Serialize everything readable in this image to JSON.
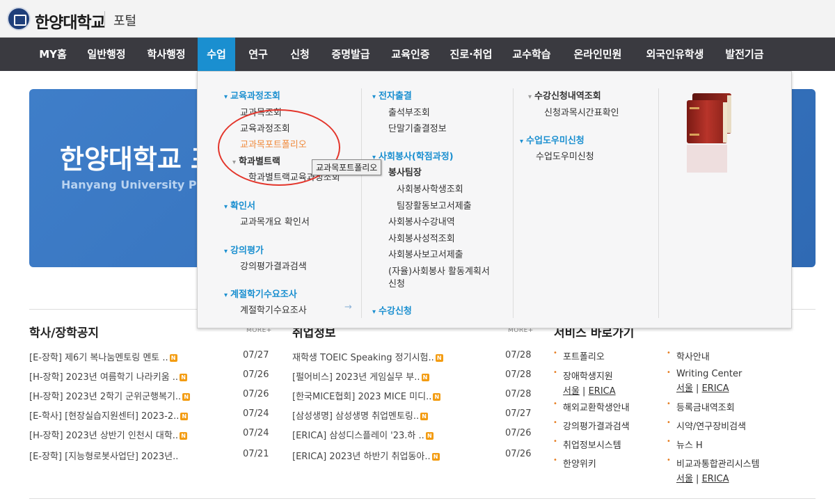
{
  "header": {
    "logo": "한양대학교",
    "portal": "포털"
  },
  "gnb": [
    {
      "label": "MY홈"
    },
    {
      "label": "일반행정"
    },
    {
      "label": "학사행정"
    },
    {
      "label": "수업"
    },
    {
      "label": "연구"
    },
    {
      "label": "신청"
    },
    {
      "label": "증명발급"
    },
    {
      "label": "교육인증"
    },
    {
      "label": "진로·취업"
    },
    {
      "label": "교수학습"
    },
    {
      "label": "온라인민원"
    },
    {
      "label": "외국인유학생"
    },
    {
      "label": "발전기금"
    }
  ],
  "banner": {
    "title": "한양대학교 포",
    "subtitle": "Hanyang University Po"
  },
  "mega": {
    "col1": {
      "h1": "교육과정조회",
      "i1": "교과목조회",
      "i2": "교육과정조회",
      "i3": "교과목포트폴리오",
      "h2": "학과별트랙",
      "i4": "학과별트랙교육과정조회",
      "h3": "확인서",
      "i5": "교과목개요 확인서",
      "h4": "강의평가",
      "i6": "강의평가결과검색",
      "h5": "계절학기수요조사",
      "i7": "계절학기수요조사"
    },
    "col2": {
      "h1": "전자출결",
      "i1": "출석부조회",
      "i2": "단말기출결정보",
      "h2": "사회봉사(학점과정)",
      "i3": "봉사팀장",
      "i4": "사회봉사학생조회",
      "i5": "팀장활동보고서제출",
      "i6": "사회봉사수강내역",
      "i7": "사회봉사성적조회",
      "i8": "사회봉사보고서제출",
      "i9a": "(자율)사회봉사 활동계획서",
      "i9b": "신청",
      "h3": "수강신청"
    },
    "col3": {
      "h1": "수강신청내역조회",
      "i1": "신청과목시간표확인",
      "h2": "수업도우미신청",
      "i2": "수업도우미신청"
    },
    "tooltip": "교과목포트폴리오"
  },
  "notice": {
    "title": "학사/장학공지",
    "more": "MORE+",
    "rows": [
      {
        "t": "[E-장학] 제6기 복나눔멘토링 멘토 ..",
        "d": "07/27"
      },
      {
        "t": "[H-장학] 2023년 여름학기 나라키움 ..",
        "d": "07/26"
      },
      {
        "t": "[H-장학] 2023년 2학기 군위군행복기..",
        "d": "07/26"
      },
      {
        "t": "[E-학사] [현장실습지원센터] 2023-2..",
        "d": "07/24"
      },
      {
        "t": "[H-장학] 2023년 상반기 인천시 대학..",
        "d": "07/24"
      },
      {
        "t": "[E-장학] [지능형로봇사업단] 2023년..",
        "d": "07/21"
      }
    ]
  },
  "jobs": {
    "title": "취업정보",
    "more": "MORE+",
    "rows": [
      {
        "t": "재학생 TOEIC Speaking 정기시험..",
        "d": "07/28"
      },
      {
        "t": "[펄어비스] 2023년 게임실무 부..",
        "d": "07/28"
      },
      {
        "t": "[한국MICE협회] 2023 MICE 미디..",
        "d": "07/28"
      },
      {
        "t": "[삼성생명] 삼성생명 취업멘토링..",
        "d": "07/27"
      },
      {
        "t": "[ERICA] 삼성디스플레이 '23.하 ..",
        "d": "07/26"
      },
      {
        "t": "[ERICA] 2023년 하반기 취업동아..",
        "d": "07/26"
      }
    ]
  },
  "services": {
    "title": "서비스 바로가기",
    "left": [
      "포트폴리오",
      "장애학생지원",
      "해외교환학생안내",
      "강의평가결과검색",
      "취업정보시스템",
      "한양위키"
    ],
    "right": [
      "학사안내",
      "Writing Center",
      "등록금내역조회",
      "시약/연구장비검색",
      "뉴스 H",
      "비교과통합관리시스템"
    ],
    "seoul": "서울",
    "erica": "ERICA",
    "sep": " | "
  },
  "badge": "N"
}
